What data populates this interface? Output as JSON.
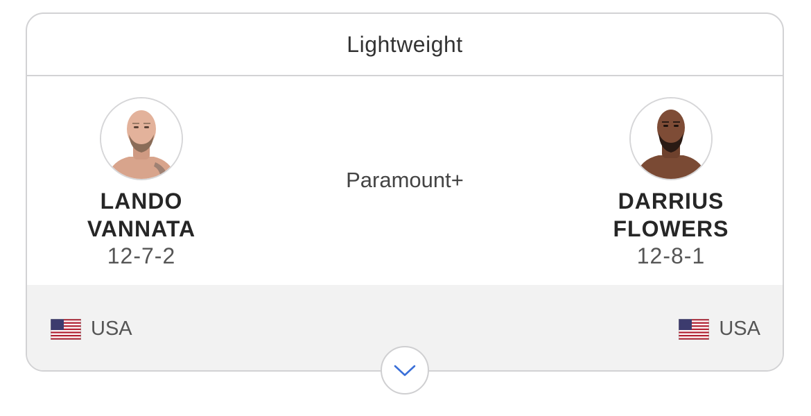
{
  "weight_class": "Lightweight",
  "broadcast": "Paramount+",
  "fighters": {
    "left": {
      "first_name": "LANDO",
      "last_name": "VANNATA",
      "record": "12-7-2",
      "country": "USA"
    },
    "right": {
      "first_name": "DARRIUS",
      "last_name": "FLOWERS",
      "record": "12-8-1",
      "country": "USA"
    }
  },
  "icons": {
    "flag": "us-flag-icon",
    "expand": "chevron-down-icon"
  },
  "colors": {
    "accent": "#3a6fd8",
    "border": "#d2d2d4",
    "footer_bg": "#f2f2f2",
    "name_text": "#262626"
  }
}
